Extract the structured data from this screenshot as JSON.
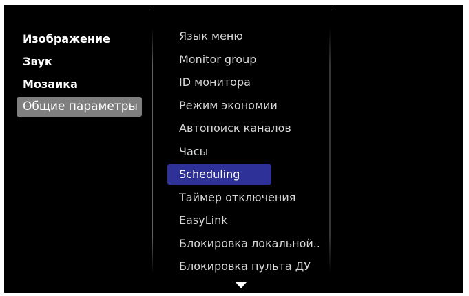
{
  "left_menu": {
    "items": [
      {
        "label": "Изображение"
      },
      {
        "label": "Звук"
      },
      {
        "label": "Мозаика"
      },
      {
        "label": "Общие параметры",
        "selected": true
      }
    ]
  },
  "submenu": {
    "items": [
      {
        "label": "Язык меню"
      },
      {
        "label": "Monitor group"
      },
      {
        "label": "ID монитора"
      },
      {
        "label": "Режим экономии"
      },
      {
        "label": "Автопоиск каналов"
      },
      {
        "label": "Часы"
      },
      {
        "label": "Scheduling",
        "selected": true
      },
      {
        "label": "Таймер отключения"
      },
      {
        "label": "EasyLink"
      },
      {
        "label": "Блокировка локальной..."
      },
      {
        "label": "Блокировка пульта ДУ"
      }
    ],
    "more_icon": "triangle-down-icon"
  },
  "colors": {
    "background": "#000000",
    "left_selected": "#7f7f7f",
    "sub_selected": "#2e3198",
    "text": "#ffffff"
  }
}
